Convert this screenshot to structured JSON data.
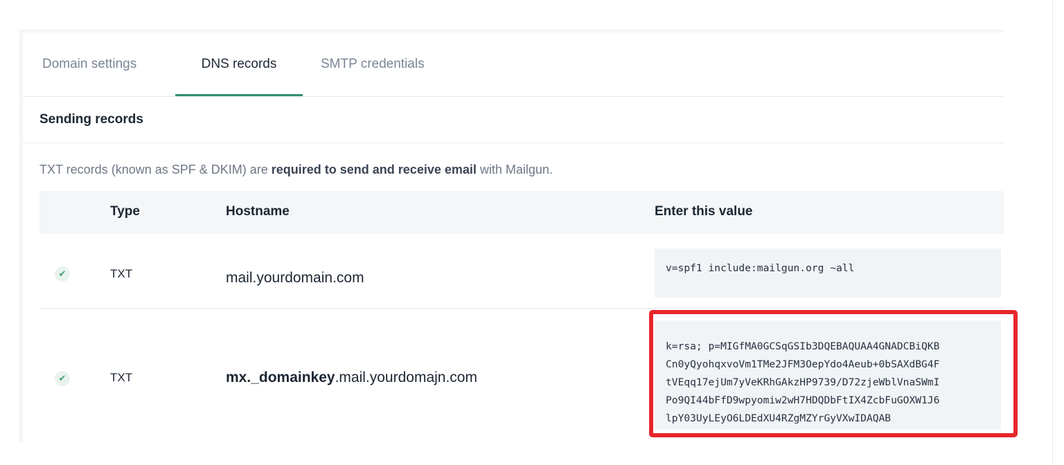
{
  "tabs": [
    {
      "label": "Domain settings",
      "active": false
    },
    {
      "label": "DNS records",
      "active": true
    },
    {
      "label": "SMTP credentials",
      "active": false
    }
  ],
  "section_title": "Sending records",
  "intro": {
    "prefix": "TXT records (known as SPF & DKIM) are ",
    "bold": "required to send and receive email",
    "suffix": " with Mailgun."
  },
  "table": {
    "columns": [
      "Type",
      "Hostname",
      "Enter this value"
    ],
    "rows": [
      {
        "status_icon": "check-icon",
        "type": "TXT",
        "host_bold": "",
        "host_rest": "mail.yourdomain.com",
        "value": "v=spf1 include:mailgun.org ~all"
      },
      {
        "status_icon": "check-icon",
        "type": "TXT",
        "host_bold": "mx._domainkey",
        "host_rest": ".mail.yourdomajn.com",
        "value_lines": [
          "k=rsa; p=MIGfMA0GCSqGSIb3DQEBAQUAA4GNADCBiQKB",
          "Cn0yQyohqxvoVm1TMe2JFM3OepYdo4Aeub+0bSAXdBG4F",
          "tVEqq17ejUm7yVeKRhGAkzHP9739/D72zjeWblVnaSWmI",
          "Po9QI44bFfD9wpyomiw2wH7HDQDbFtIX4ZcbFuGOXW1J6",
          "lpY03UyLEyO6LDEdXU4RZgMZYrGyVXwIDAQAB"
        ]
      }
    ]
  },
  "colors": {
    "active_tab_underline": "#2f8f72",
    "highlight_border": "#e7262a"
  }
}
